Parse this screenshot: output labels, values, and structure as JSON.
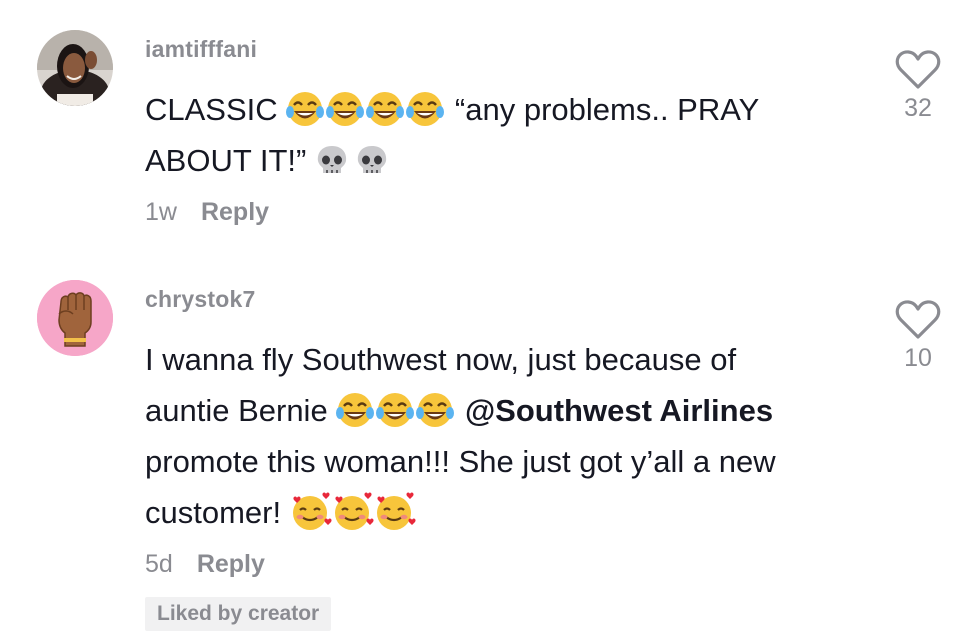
{
  "comments": [
    {
      "username": "iamtifffani",
      "line1_text": "CLASSIC",
      "line1_quote": "“any problems.. PRAY",
      "line2_text": "ABOUT IT!”",
      "age": "1w",
      "reply_label": "Reply",
      "like_count": "32",
      "emojis_line1": [
        "face-with-tears-of-joy-icon",
        "face-with-tears-of-joy-icon",
        "face-with-tears-of-joy-icon",
        "face-with-tears-of-joy-icon"
      ],
      "emojis_line2": [
        "skull-icon",
        "skull-icon"
      ]
    },
    {
      "username": "chrystok7",
      "line1": "I wanna fly Southwest now, just because of",
      "line2_text": "auntie Bernie",
      "line2_mention": "@Southwest Airlines",
      "line3": "promote this woman!!! She just got y’all a new",
      "line4_text": "customer!",
      "age": "5d",
      "reply_label": "Reply",
      "like_count": "10",
      "badge": "Liked by creator",
      "emojis_line2": [
        "face-with-tears-of-joy-icon",
        "face-with-tears-of-joy-icon",
        "face-with-tears-of-joy-icon"
      ],
      "emojis_line4": [
        "smiling-face-with-hearts-icon",
        "smiling-face-with-hearts-icon",
        "smiling-face-with-hearts-icon"
      ]
    }
  ],
  "colors": {
    "text_primary": "#161823",
    "text_secondary": "#8a8b91",
    "badge_bg": "#f1f1f2",
    "avatar2_bg": "#f6a6c8"
  }
}
